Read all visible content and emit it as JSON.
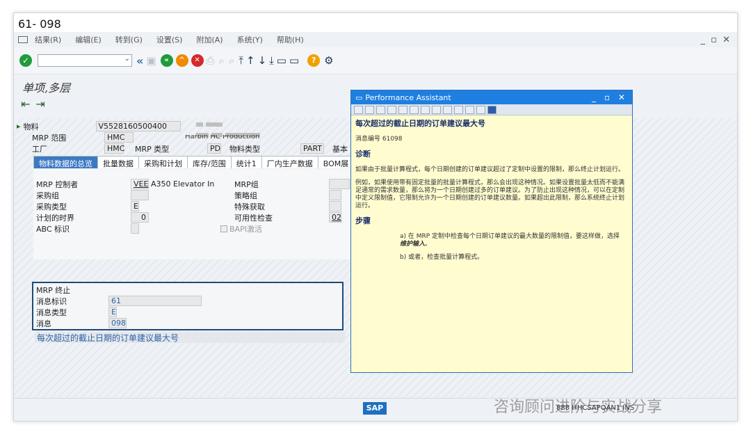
{
  "window": {
    "title": "61- 098"
  },
  "menu": [
    "结果(R)",
    "编辑(E)",
    "转到(G)",
    "设置(S)",
    "附加(A)",
    "系统(Y)",
    "帮助(H)"
  ],
  "window_controls": "_ ▫ ✕",
  "page_title": "单项,多层",
  "header": {
    "material_label": "物料",
    "material_value": "V5528160500400",
    "mrp_area_label": "MRP 范围",
    "mrp_area_value": "HMC",
    "plant_label": "工厂",
    "plant_value": "HMC",
    "mrp_type_label": "MRP 类型",
    "mrp_type_value": "PD",
    "mat_type_label": "物料类型",
    "mat_type_value": "PART",
    "basic_label": "基本",
    "plant_desc_partial": "Harbin HC Production"
  },
  "tabs": [
    "物料数据的总览",
    "批量数据",
    "采购和计划",
    "库存/范围",
    "统计1",
    "厂内生产数据",
    "BOM展"
  ],
  "panel": {
    "mrp_ctrl_label": "MRP 控制者",
    "mrp_ctrl_value": "VEE",
    "mrp_ctrl_desc": "A350 Elevator In",
    "mrp_group_label": "MRP组",
    "purch_group_label": "采购组",
    "strategy_group_label": "策略组",
    "proc_type_label": "采购类型",
    "proc_type_value": "E",
    "special_proc_label": "特殊获取",
    "plan_fence_label": "计划的时界",
    "plan_fence_value": "0",
    "avail_check_label": "可用性检查",
    "avail_check_value": "02",
    "abc_label": "ABC 标识",
    "bapi_label": "BAPI激活"
  },
  "mrp_stop": {
    "title": "MRP 终止",
    "msg_id_label": "消息标识",
    "msg_id_value": "61",
    "msg_type_label": "消息类型",
    "msg_type_value": "E",
    "msg_label": "消息",
    "msg_value": "098",
    "msg_text": "每次超过的截止日期的订单建议最大号"
  },
  "perf": {
    "title": "Performance Assistant",
    "heading": "每次超过的截止日期的订单建议最大号",
    "msg_no": "消息编号 61098",
    "diag_title": "诊断",
    "diag_p1": "如果由于批量计算程式，每个日期创建的订单建议超过了定制中设置的限制，那么终止计划运行。",
    "diag_p2": "例如，如果使用带有固定批量的批量计算程式，那么会出现这种情况。如果设置批量太低而不能满足通常的需求数量，那么将为一个日期创建过多的订单建议。为了防止出现这种情况，可以在定制中定义限制值，它限制允许为一个日期创建的订单建议数量。如果超出此限制，那么系统终止计划运行。",
    "steps_title": "步骤",
    "step_a1": "a) 在 MRP 定制中检查每个日期订单建议的最大数量的限制值，要这样做，选择",
    "step_a2": "维护输入",
    "step_a3": "。",
    "step_b": "b) 或者，检查批量计算程式。"
  },
  "status": {
    "sap": "SAP",
    "system": "888  HHCSAPQAN1  INS",
    "watermark": "咨询顾问进阶与实战分享"
  }
}
